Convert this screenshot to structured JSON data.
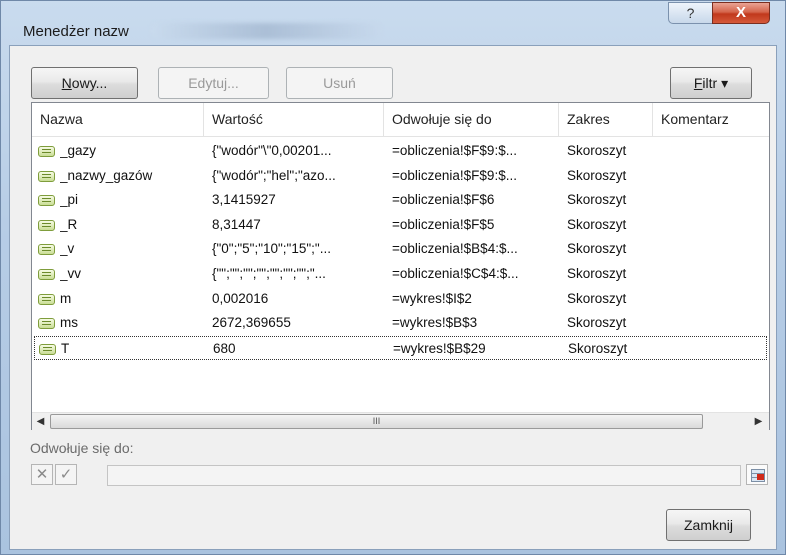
{
  "window": {
    "title": "Menedżer nazw",
    "help_label": "?",
    "close_label": "X"
  },
  "toolbar": {
    "new_label_first": "N",
    "new_label_rest": "owy...",
    "edit_label": "Edytuj...",
    "delete_label": "Usuń",
    "filter_label_first": "F",
    "filter_label_rest": "iltr ▾"
  },
  "table": {
    "columns": [
      "Nazwa",
      "Wartość",
      "Odwołuje się do",
      "Zakres",
      "Komentarz"
    ],
    "rows": [
      {
        "name": "_gazy",
        "value": "{\"wodór\"\\\"0,00201...",
        "refers": "=obliczenia!$F$9:$...",
        "scope": "Skoroszyt",
        "comment": ""
      },
      {
        "name": "_nazwy_gazów",
        "value": "{\"wodór\";\"hel\";\"azo...",
        "refers": "=obliczenia!$F$9:$...",
        "scope": "Skoroszyt",
        "comment": ""
      },
      {
        "name": "_pi",
        "value": "3,1415927",
        "refers": "=obliczenia!$F$6",
        "scope": "Skoroszyt",
        "comment": ""
      },
      {
        "name": "_R",
        "value": "8,31447",
        "refers": "=obliczenia!$F$5",
        "scope": "Skoroszyt",
        "comment": ""
      },
      {
        "name": "_v",
        "value": "{\"0\";\"5\";\"10\";\"15\";\"...",
        "refers": "=obliczenia!$B$4:$...",
        "scope": "Skoroszyt",
        "comment": ""
      },
      {
        "name": "_vv",
        "value": "{\"\";\"\";\"\";\"\";\"\";\"\";\"\";\"...",
        "refers": "=obliczenia!$C$4:$...",
        "scope": "Skoroszyt",
        "comment": ""
      },
      {
        "name": "m",
        "value": "0,002016",
        "refers": "=wykres!$I$2",
        "scope": "Skoroszyt",
        "comment": ""
      },
      {
        "name": "ms",
        "value": "2672,369655",
        "refers": "=wykres!$B$3",
        "scope": "Skoroszyt",
        "comment": ""
      },
      {
        "name": "T",
        "value": "680",
        "refers": "=wykres!$B$29",
        "scope": "Skoroszyt",
        "comment": ""
      }
    ],
    "selected_index": 8
  },
  "scrollbar": {
    "left_arrow": "◀",
    "right_arrow": "▶",
    "grip": "III"
  },
  "refers_to": {
    "label": "Odwołuje się do:",
    "value": "",
    "cancel_glyph": "✕",
    "confirm_glyph": "✓"
  },
  "footer": {
    "close_label": "Zamknij"
  }
}
